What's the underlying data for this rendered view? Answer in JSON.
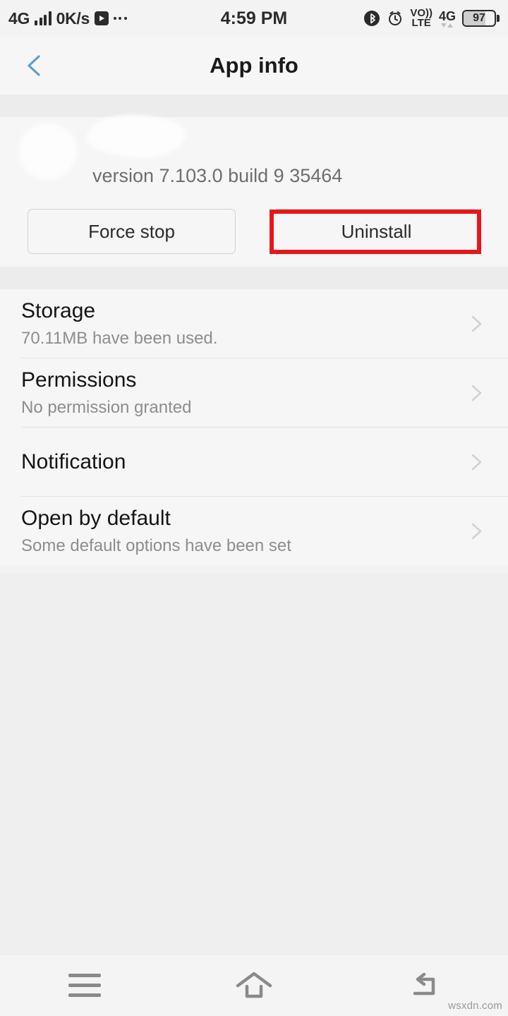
{
  "status_bar": {
    "network_label": "4G",
    "data_speed": "0K/s",
    "play_icon": "play-icon",
    "overflow_icon": "more-dots-icon",
    "time": "4:59 PM",
    "bluetooth_icon": "bluetooth-icon",
    "alarm_icon": "alarm-clock-icon",
    "volte_top": "VO))",
    "volte_bottom": "LTE",
    "network_right_label": "4G",
    "battery_percent": "97"
  },
  "title_bar": {
    "back_icon": "back-chevron-icon",
    "title": "App info"
  },
  "app_header": {
    "icon": "app-icon-redacted",
    "name_redacted": "app-name-redacted",
    "version": "version 7.103.0 build 9 35464"
  },
  "actions": {
    "force_stop_label": "Force stop",
    "uninstall_label": "Uninstall",
    "highlight_color": "#e8151b"
  },
  "settings_list": [
    {
      "title": "Storage",
      "subtitle": "70.11MB have been used.",
      "chevron": "chevron-right-icon"
    },
    {
      "title": "Permissions",
      "subtitle": "No permission granted",
      "chevron": "chevron-right-icon"
    },
    {
      "title": "Notification",
      "subtitle": "",
      "chevron": "chevron-right-icon"
    },
    {
      "title": "Open by default",
      "subtitle": "Some default options have been set",
      "chevron": "chevron-right-icon"
    }
  ],
  "nav_bar": {
    "menu_icon": "menu-icon",
    "home_icon": "home-icon",
    "back_icon": "back-arrow-icon"
  },
  "watermark": "wsxdn.com"
}
